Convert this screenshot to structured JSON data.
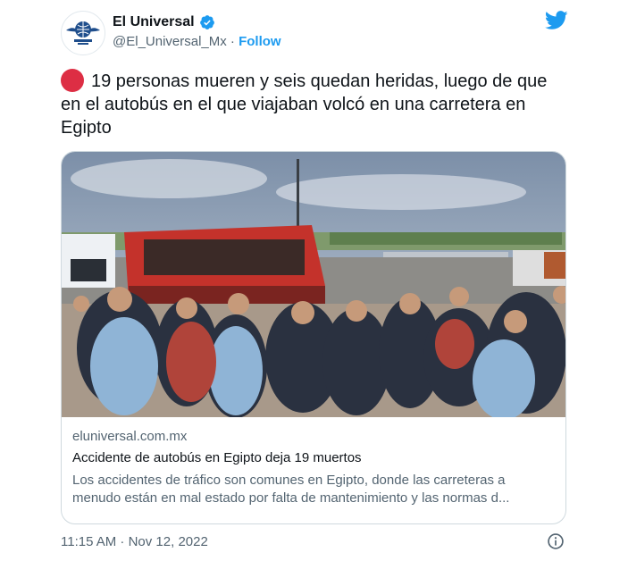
{
  "tweet": {
    "author": {
      "display_name": "El Universal",
      "handle": "@El_Universal_Mx",
      "separator": " · ",
      "follow_label": "Follow",
      "avatar_icon": "el-universal-logo",
      "verified_color": "#1d9bf0"
    },
    "text": "19 personas mueren y seis quedan heridas, luego de que en el autobús en el que viajaban volcó en una carretera en Egipto",
    "emoji": "red-circle",
    "card": {
      "image_alt": "bus accident scene with crowd in Egypt",
      "domain": "eluniversal.com.mx",
      "title": "Accidente de autobús en Egipto deja 19 muertos",
      "description": "Los accidentes de tráfico son comunes en Egipto, donde las carreteras a menudo están en mal estado por falta de mantenimiento y las normas d..."
    },
    "timestamp": "11:15 AM · Nov 12, 2022",
    "brand_color": "#1d9bf0"
  }
}
